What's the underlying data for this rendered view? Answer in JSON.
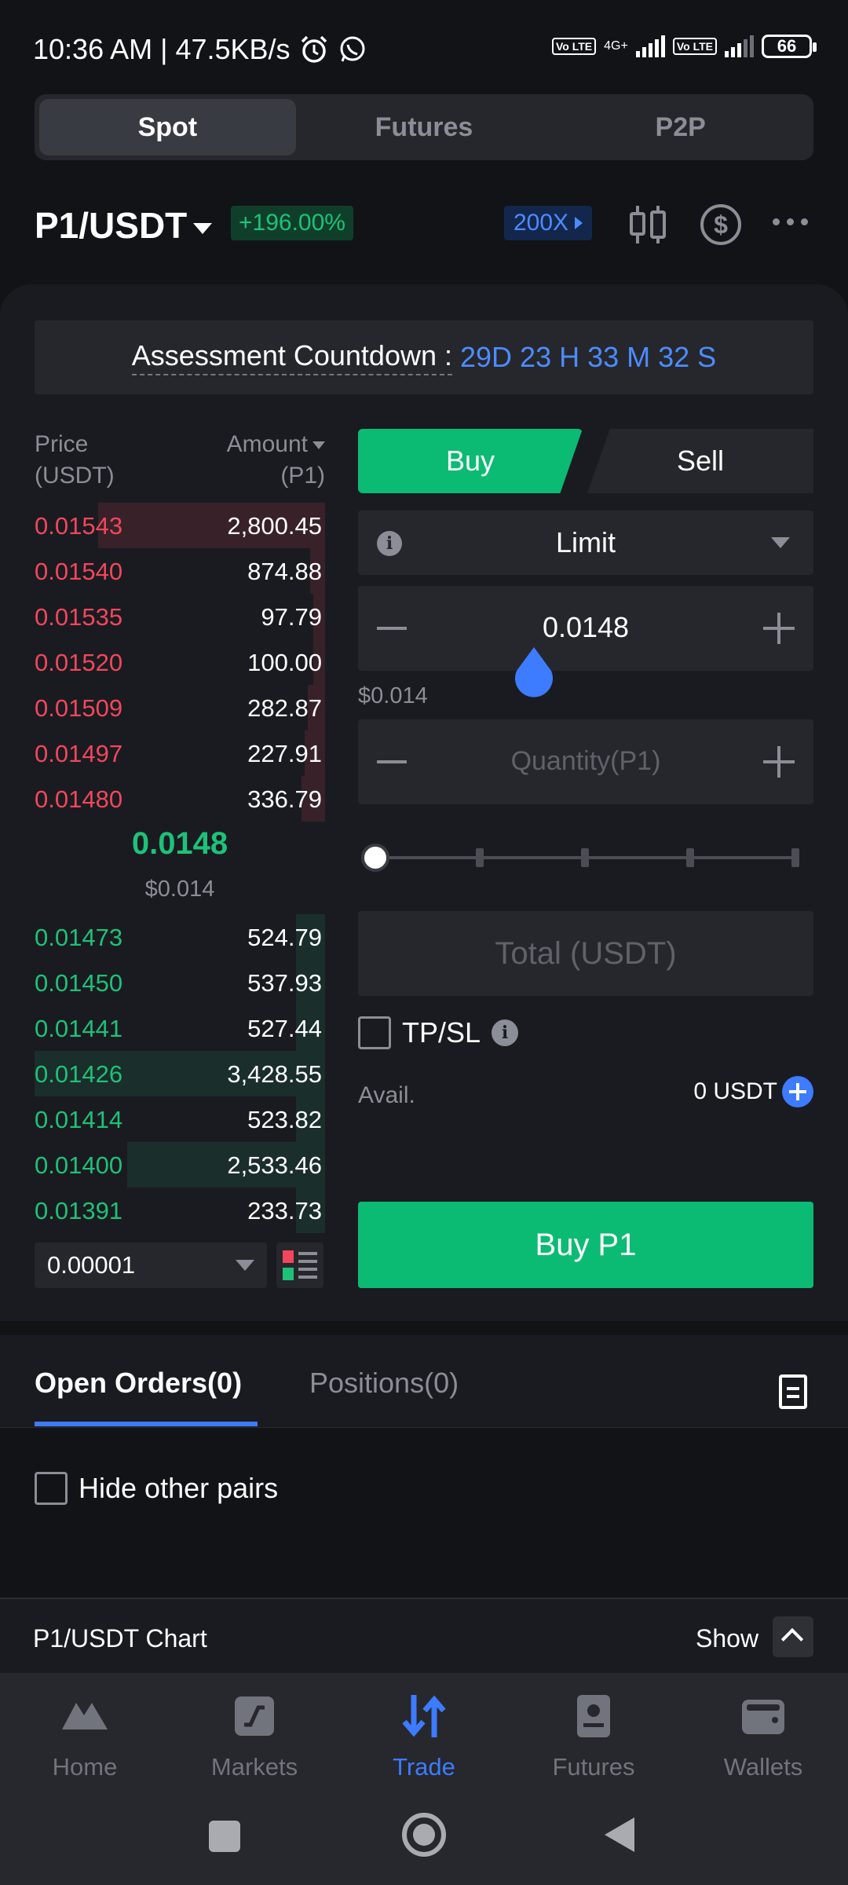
{
  "status_bar": {
    "time_speed": "10:36 AM | 47.5KB/s",
    "network": "4G+",
    "volte": "Vo LTE",
    "battery": "66"
  },
  "top_tabs": [
    {
      "label": "Spot",
      "active": true
    },
    {
      "label": "Futures",
      "active": false
    },
    {
      "label": "P2P",
      "active": false
    }
  ],
  "pair": {
    "name": "P1/USDT",
    "change": "+196.00%",
    "leverage": "200X"
  },
  "countdown": {
    "label": "Assessment Countdown :",
    "value": "29D 23 H 33 M 32 S"
  },
  "orderbook": {
    "price_header": [
      "Price",
      "(USDT)"
    ],
    "amount_header": [
      "Amount",
      "(P1)"
    ],
    "asks": [
      {
        "price": "0.01543",
        "amount": "2,800.45",
        "depth": 0.78
      },
      {
        "price": "0.01540",
        "amount": "874.88",
        "depth": 0.05
      },
      {
        "price": "0.01535",
        "amount": "97.79",
        "depth": 0.04
      },
      {
        "price": "0.01520",
        "amount": "100.00",
        "depth": 0.04
      },
      {
        "price": "0.01509",
        "amount": "282.87",
        "depth": 0.06
      },
      {
        "price": "0.01497",
        "amount": "227.91",
        "depth": 0.07
      },
      {
        "price": "0.01480",
        "amount": "336.79",
        "depth": 0.08
      }
    ],
    "mid_price": "0.0148",
    "mid_usd": "$0.014",
    "bids": [
      {
        "price": "0.01473",
        "amount": "524.79",
        "depth": 0.1
      },
      {
        "price": "0.01450",
        "amount": "537.93",
        "depth": 0.1
      },
      {
        "price": "0.01441",
        "amount": "527.44",
        "depth": 0.1
      },
      {
        "price": "0.01426",
        "amount": "3,428.55",
        "depth": 1.0
      },
      {
        "price": "0.01414",
        "amount": "523.82",
        "depth": 0.1
      },
      {
        "price": "0.01400",
        "amount": "2,533.46",
        "depth": 0.68
      },
      {
        "price": "0.01391",
        "amount": "233.73",
        "depth": 0.1
      }
    ],
    "precision": "0.00001"
  },
  "order_form": {
    "buy_label": "Buy",
    "sell_label": "Sell",
    "order_type": "Limit",
    "price_value": "0.0148",
    "price_usd": "$0.014",
    "quantity_placeholder": "Quantity(P1)",
    "total_placeholder": "Total (USDT)",
    "slider_percent": 0,
    "tpsl_label": "TP/SL",
    "avail_label": "Avail.",
    "avail_value": "0 USDT",
    "submit_label": "Buy P1"
  },
  "orders": {
    "tab_open": "Open Orders(0)",
    "tab_positions": "Positions(0)",
    "hide_label": "Hide other pairs"
  },
  "chart_bar": {
    "label": "P1/USDT Chart",
    "show_label": "Show"
  },
  "bottom_nav": [
    {
      "label": "Home",
      "icon": "home-icon",
      "active": false
    },
    {
      "label": "Markets",
      "icon": "markets-icon",
      "active": false
    },
    {
      "label": "Trade",
      "icon": "trade-icon",
      "active": true
    },
    {
      "label": "Futures",
      "icon": "futures-icon",
      "active": false
    },
    {
      "label": "Wallets",
      "icon": "wallet-icon",
      "active": false
    }
  ],
  "colors": {
    "buy": "#0cbb73",
    "sell": "#f0475c",
    "accent": "#3d7bff",
    "background": "#121317"
  }
}
